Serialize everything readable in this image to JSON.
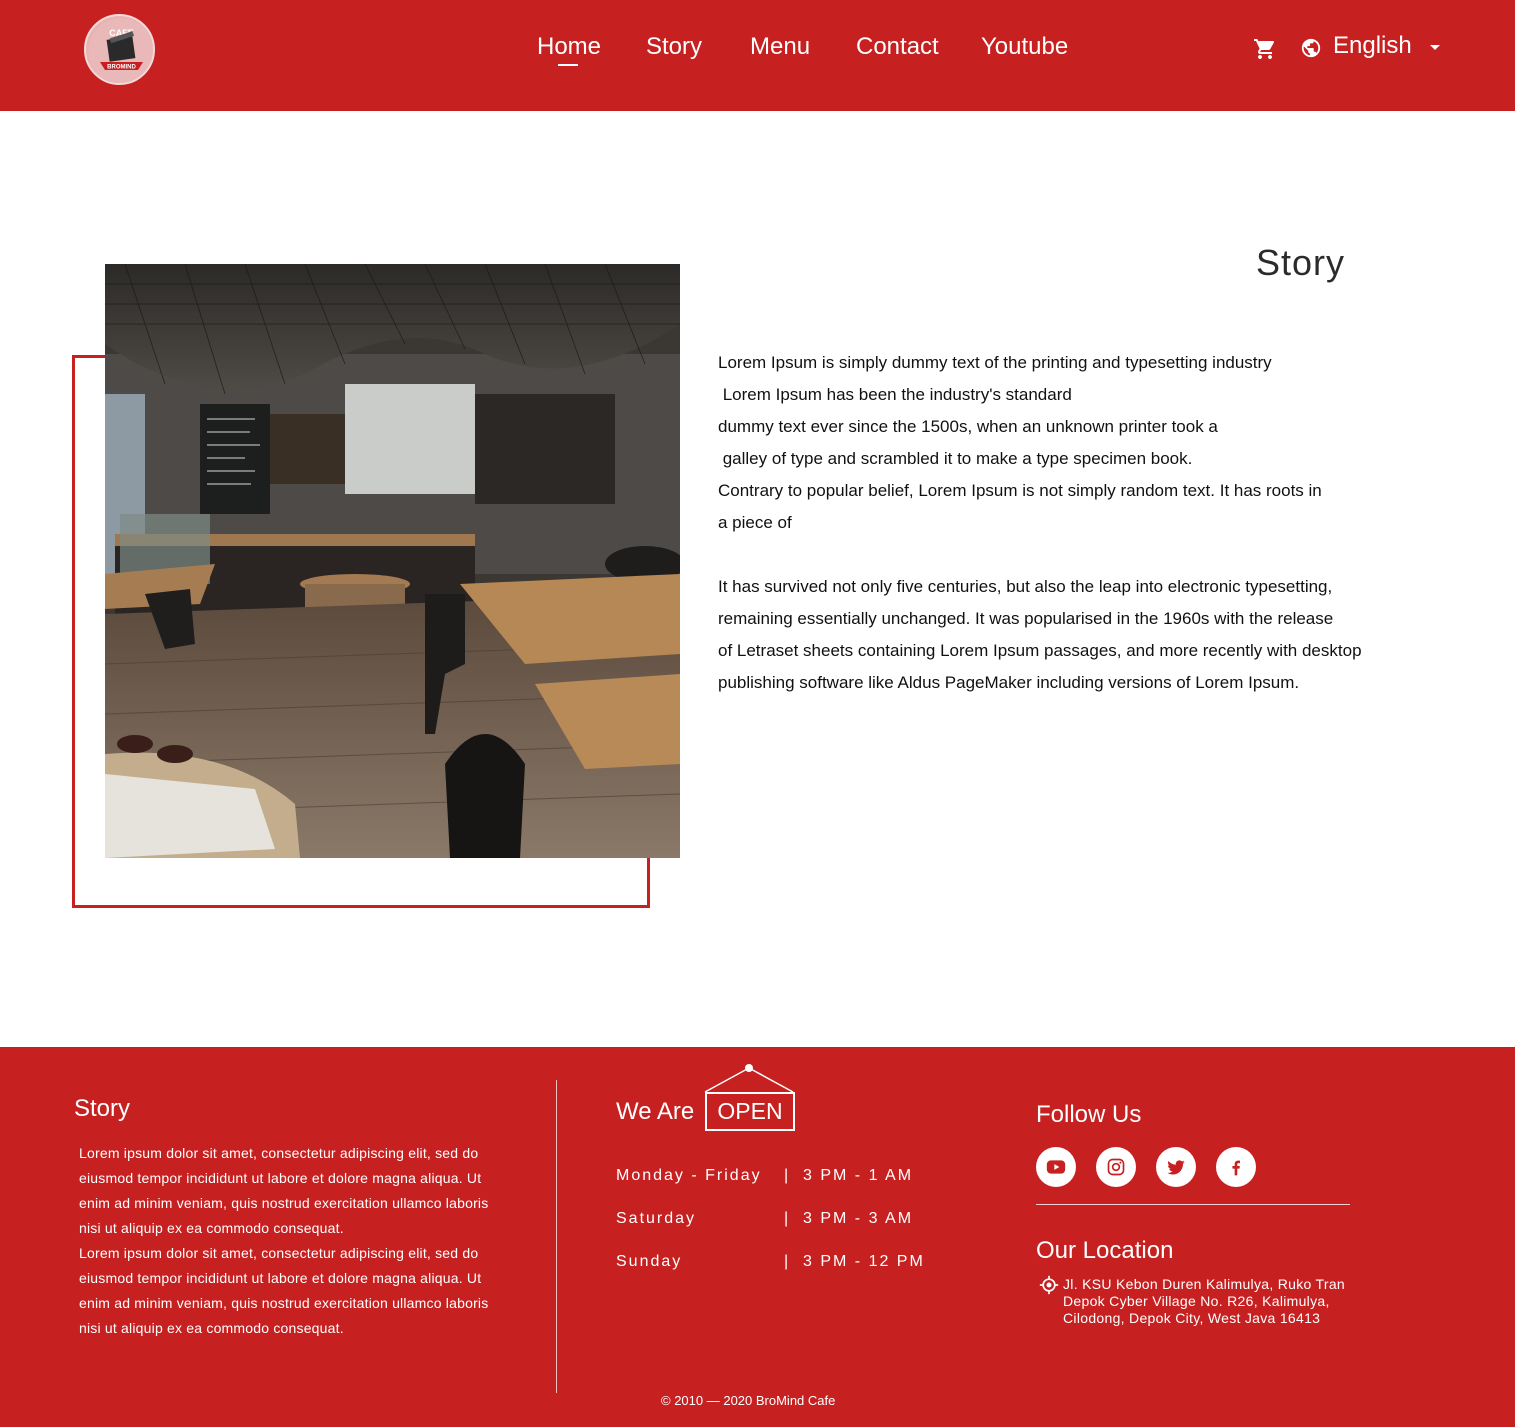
{
  "header": {
    "nav": [
      {
        "label": "Home",
        "active": true
      },
      {
        "label": "Story"
      },
      {
        "label": "Menu"
      },
      {
        "label": "Contact"
      },
      {
        "label": "Youtube"
      }
    ],
    "language": "English",
    "icons": [
      "logo",
      "cart-icon",
      "globe-icon",
      "caret-down-icon"
    ]
  },
  "story": {
    "title": "Story",
    "lines": [
      "Lorem Ipsum is simply dummy text of the printing and typesetting industry",
      " Lorem Ipsum has been the industry's standard",
      "dummy text ever since the 1500s, when an unknown printer took a",
      " galley of type and scrambled it to make a type specimen book.",
      "Contrary to popular belief, Lorem Ipsum is not simply random text. It has roots in",
      "a piece of",
      "",
      "It has survived not only five centuries, but also the leap into electronic typesetting,",
      "remaining essentially unchanged. It was popularised in the 1960s with the release",
      "of Letraset sheets containing Lorem Ipsum passages, and more recently with desktop",
      "publishing software like Aldus PageMaker including versions of Lorem Ipsum."
    ]
  },
  "footer": {
    "story_title": "Story",
    "story_lines": [
      "Lorem ipsum dolor sit amet, consectetur adipiscing elit, sed do",
      "eiusmod tempor incididunt ut labore et dolore magna aliqua. Ut",
      "enim ad minim veniam, quis nostrud exercitation ullamco laboris",
      "nisi ut aliquip ex ea commodo consequat.",
      "Lorem ipsum dolor sit amet, consectetur adipiscing elit, sed do",
      "eiusmod tempor incididunt ut labore et dolore magna aliqua. Ut",
      "enim ad minim veniam, quis nostrud exercitation ullamco laboris",
      "nisi ut aliquip ex ea commodo consequat."
    ],
    "we_are": "We Are",
    "open_sign": "OPEN",
    "hours": [
      {
        "day": "Monday - Friday",
        "sep": "|",
        "time": "3 PM - 1 AM"
      },
      {
        "day": "Saturday",
        "sep": "|",
        "time": "3 PM - 3 AM"
      },
      {
        "day": "Sunday",
        "sep": "|",
        "time": "3 PM - 12 PM"
      }
    ],
    "follow_title": "Follow Us",
    "socials": [
      "youtube-icon",
      "instagram-icon",
      "twitter-icon",
      "facebook-icon"
    ],
    "location_title": "Our Location",
    "address_lines": [
      "Jl. KSU Kebon Duren Kalimulya, Ruko Tran",
      "Depok Cyber Village No. R26, Kalimulya,",
      "Cilodong, Depok City, West Java 16413"
    ],
    "copyright": "© 2010 — 2020  BroMind Cafe"
  },
  "colors": {
    "brand_red": "#c62021",
    "text": "#111111",
    "white": "#ffffff"
  }
}
